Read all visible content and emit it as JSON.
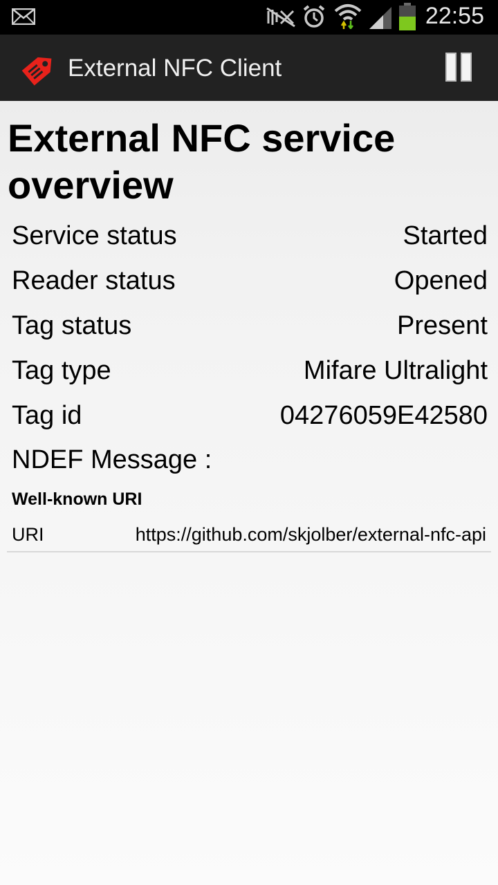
{
  "status_bar": {
    "time": "22:55",
    "icons": [
      "mail-icon",
      "nfc-mute-icon",
      "alarm-icon",
      "wifi-icon",
      "signal-icon",
      "battery-icon"
    ]
  },
  "action_bar": {
    "title": "External NFC Client",
    "logo_icon": "nfc-tag-logo-icon",
    "action_icon": "pause-icon",
    "logo_color": "#e8221b"
  },
  "main": {
    "title": "External NFC service overview",
    "rows": [
      {
        "label": "Service status",
        "value": "Started"
      },
      {
        "label": "Reader status",
        "value": "Opened"
      },
      {
        "label": "Tag status",
        "value": "Present"
      },
      {
        "label": "Tag type",
        "value": "Mifare Ultralight"
      },
      {
        "label": "Tag id",
        "value": "04276059E42580"
      }
    ],
    "ndef_heading": "NDEF Message :",
    "record": {
      "type": "Well-known URI",
      "field_label": "URI",
      "field_value": "https://github.com/skjolber/external-nfc-api"
    }
  }
}
